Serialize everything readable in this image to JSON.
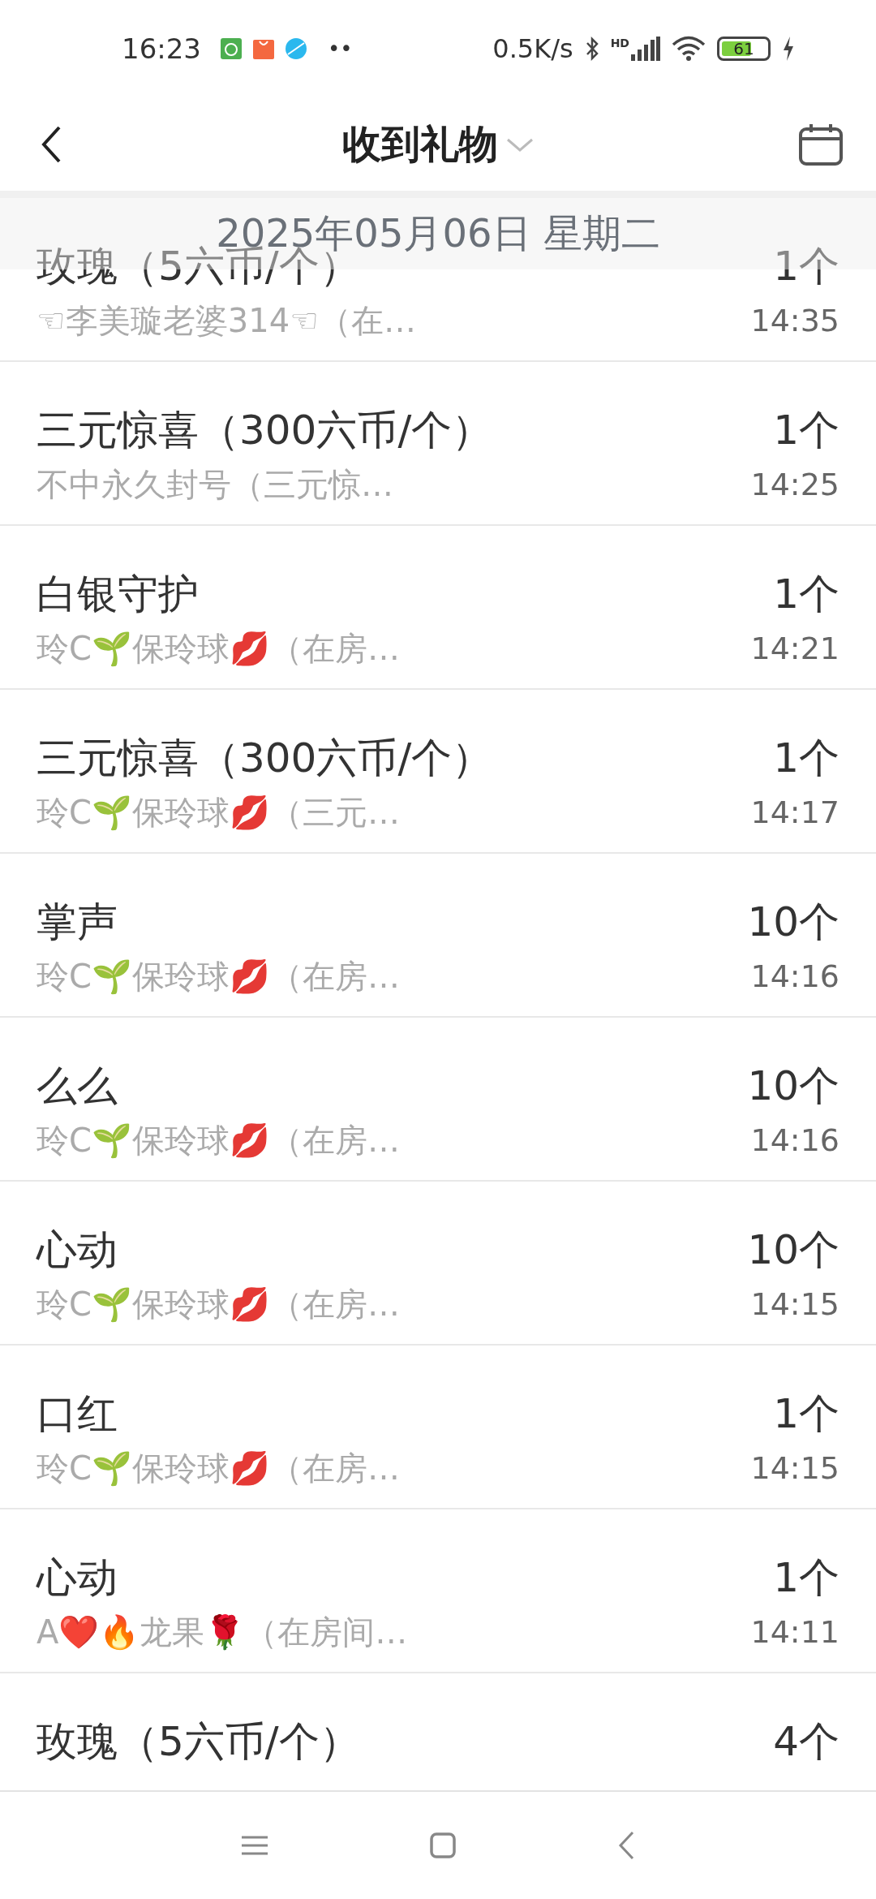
{
  "status_bar": {
    "time": "16:23",
    "more": "••",
    "net_speed": "0.5K/s",
    "signal_label": "HD",
    "battery": "61"
  },
  "header": {
    "title": "收到礼物"
  },
  "date_header": "2025年05月06日 星期二",
  "gifts": [
    {
      "name": "玫瑰（5六币/个）",
      "sender": "☜李美璇老婆314☜（在…",
      "count": "1个",
      "time": "14:35"
    },
    {
      "name": "三元惊喜（300六币/个）",
      "sender": "不中永久封号（三元惊…",
      "count": "1个",
      "time": "14:25"
    },
    {
      "name": "白银守护",
      "sender": "玲C🌱保玲球💋（在房…",
      "count": "1个",
      "time": "14:21"
    },
    {
      "name": "三元惊喜（300六币/个）",
      "sender": "玲C🌱保玲球💋（三元…",
      "count": "1个",
      "time": "14:17"
    },
    {
      "name": "掌声",
      "sender": "玲C🌱保玲球💋（在房…",
      "count": "10个",
      "time": "14:16"
    },
    {
      "name": "么么",
      "sender": "玲C🌱保玲球💋（在房…",
      "count": "10个",
      "time": "14:16"
    },
    {
      "name": "心动",
      "sender": "玲C🌱保玲球💋（在房…",
      "count": "10个",
      "time": "14:15"
    },
    {
      "name": "口红",
      "sender": "玲C🌱保玲球💋（在房…",
      "count": "1个",
      "time": "14:15"
    },
    {
      "name": "心动",
      "sender": "A❤️🔥龙果🌹（在房间…",
      "count": "1个",
      "time": "14:11"
    },
    {
      "name": "玫瑰（5六币/个）",
      "count": "4个"
    }
  ]
}
